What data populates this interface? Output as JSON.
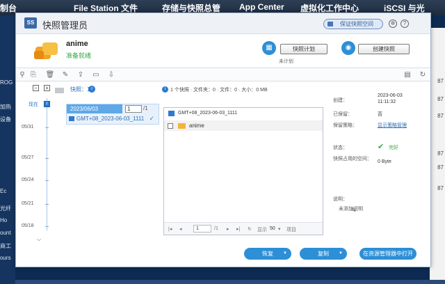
{
  "desktop": {
    "top_items": [
      "制台",
      "File Station 文件",
      "存储与快照总管",
      "App Center",
      "虚拟化工作中心",
      "iSCSI 与光"
    ],
    "left_items": [
      "ROG",
      "加热",
      "设备",
      "Ec",
      "光纤",
      "Ho",
      "ount",
      "商工",
      "ours"
    ],
    "right_items": [
      "87",
      "87",
      "87",
      "87",
      "87",
      "87"
    ]
  },
  "dialog": {
    "icon_label": "SS",
    "title": "快照管理员",
    "protect_button": "保证快照空间",
    "gear_icon": "gear-icon",
    "help_icon": "help-icon"
  },
  "share": {
    "name": "anime",
    "status": "准备就绪",
    "schedule_button": "快照计划",
    "schedule_sub": "未计划",
    "take_snapshot_button": "创建快照"
  },
  "toolbar": {
    "icons": [
      "search-icon",
      "restore-icon",
      "delete-icon",
      "edit-icon",
      "upload-icon",
      "folder-icon",
      "download-icon",
      "window-icon",
      "refresh-icon"
    ]
  },
  "timeline": {
    "minus": "−",
    "plus": "+",
    "badge": "",
    "snapshot_count": "快照：1",
    "now_label": "现在",
    "dot_label": "1",
    "dates": [
      "05/31",
      "05/27",
      "05/24",
      "05/21",
      "05/18"
    ]
  },
  "snapshot_card": {
    "date": "2023/06/03",
    "edit_value": "1",
    "total": "/1",
    "name": "GMT+08_2023-06-03_1111"
  },
  "file_panel": {
    "summary": "1 个快照 · 文件夹：0 · 文件：0 · 大小：0 MB",
    "header_name": "GMT+08_2023-06-03_1111",
    "rows": [
      {
        "name": "anime"
      }
    ],
    "pager": {
      "page": "1",
      "total_pages": "/1",
      "per_page_label": "显示",
      "per_page": "50",
      "items_label": "项目"
    }
  },
  "properties": {
    "created_label": "创建：",
    "created_date": "2023-06-03",
    "created_time": "11:11:32",
    "retain_label": "已保留：",
    "retain_value": "否",
    "policy_label": "保留策略：",
    "policy_value": "显示策略管理",
    "status_label": "状态：",
    "status_value": "完好",
    "space_label": "快照占用的空间：",
    "space_value": "0 Byte",
    "note_label": "说明：",
    "note_value": "未添加说明"
  },
  "footer": {
    "restore_button": "恢复",
    "clone_button": "复制",
    "explore_button": "在资源管理器中打开"
  },
  "colors": {
    "accent": "#2d8fd6",
    "ok": "#3aa64a"
  }
}
